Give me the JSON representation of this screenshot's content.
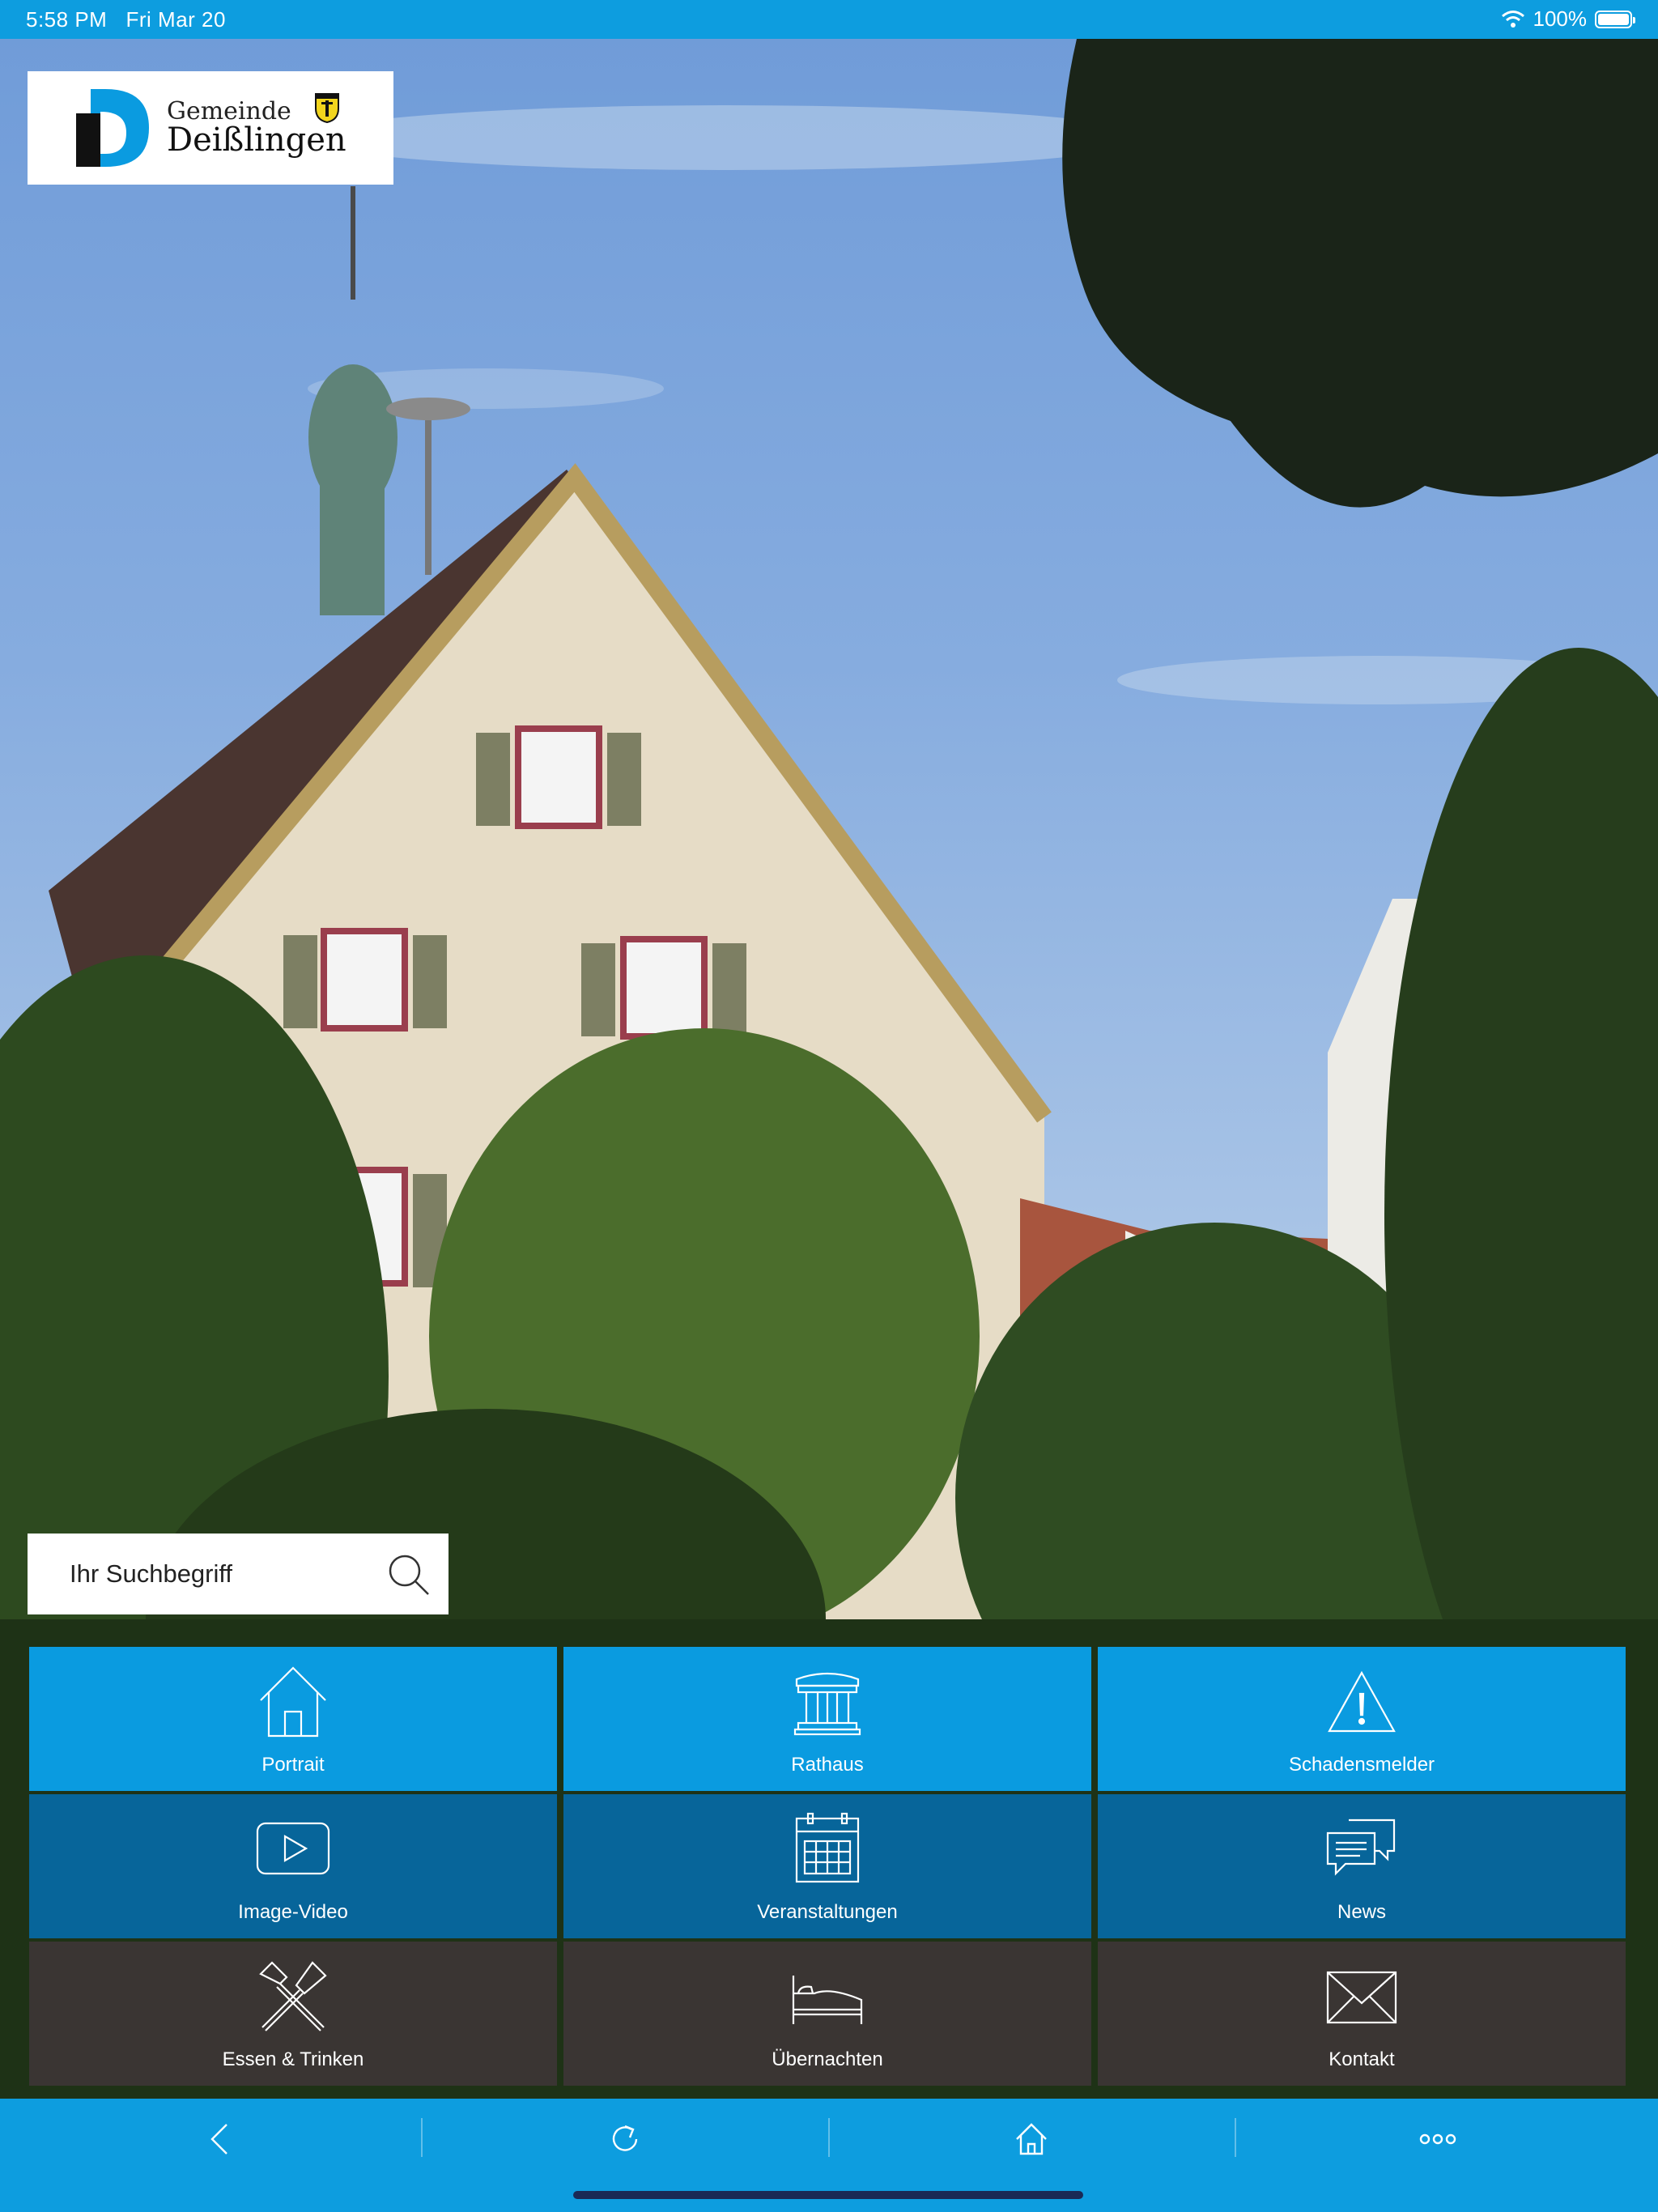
{
  "status_bar": {
    "time": "5:58 PM",
    "date": "Fri Mar 20",
    "battery": "100%",
    "battery_level": 1.0
  },
  "logo": {
    "line1": "Gemeinde",
    "line2": "Deißlingen"
  },
  "search": {
    "placeholder": "Ihr Suchbegriff"
  },
  "tiles": [
    {
      "label": "Portrait",
      "icon": "house-icon"
    },
    {
      "label": "Rathaus",
      "icon": "town-hall-icon"
    },
    {
      "label": "Schadensmelder",
      "icon": "warning-icon"
    },
    {
      "label": "Image-Video",
      "icon": "play-video-icon"
    },
    {
      "label": "Veranstaltungen",
      "icon": "calendar-icon"
    },
    {
      "label": "News",
      "icon": "chat-bubbles-icon"
    },
    {
      "label": "Essen & Trinken",
      "icon": "fork-knife-icon"
    },
    {
      "label": "Übernachten",
      "icon": "bed-icon"
    },
    {
      "label": "Kontakt",
      "icon": "envelope-icon"
    }
  ],
  "toolbar": [
    "back-icon",
    "reload-icon",
    "home-icon",
    "more-icon"
  ],
  "colors": {
    "primary": "#0d9ddf",
    "tile_row1": "#0a9be0",
    "tile_row2": "#07659a",
    "tile_row3": "#3a3533"
  }
}
